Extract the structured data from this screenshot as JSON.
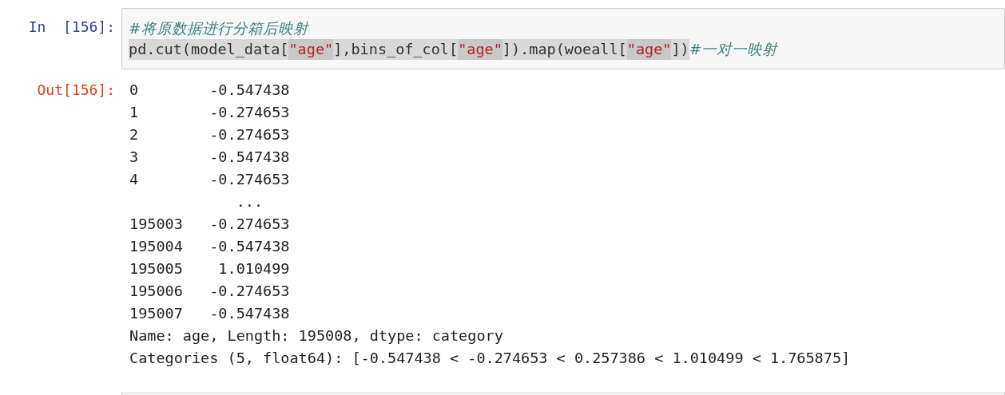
{
  "input_cell": {
    "prompt": "In  [156]:",
    "lines": [
      [
        {
          "text": "#将原数据进行分箱后映射",
          "kind": "comment",
          "highlighted": false
        }
      ],
      [
        {
          "text": "pd.cut(model_data[",
          "kind": "code",
          "highlighted": true
        },
        {
          "text": "\"age\"",
          "kind": "string",
          "highlighted": true
        },
        {
          "text": "],bins_of_col[",
          "kind": "code",
          "highlighted": true
        },
        {
          "text": "\"age\"",
          "kind": "string",
          "highlighted": true
        },
        {
          "text": "]).map(woeall[",
          "kind": "code",
          "highlighted": true
        },
        {
          "text": "\"age\"",
          "kind": "string",
          "highlighted": true
        },
        {
          "text": "])",
          "kind": "code",
          "highlighted": true
        },
        {
          "text": "#一对一映射",
          "kind": "comment",
          "highlighted": false
        }
      ]
    ]
  },
  "output_cell": {
    "prompt": "Out[156]:",
    "rows": [
      {
        "kind": "row",
        "index": "0",
        "value": "-0.547438"
      },
      {
        "kind": "row",
        "index": "1",
        "value": "-0.274653"
      },
      {
        "kind": "row",
        "index": "2",
        "value": "-0.274653"
      },
      {
        "kind": "row",
        "index": "3",
        "value": "-0.547438"
      },
      {
        "kind": "row",
        "index": "4",
        "value": "-0.274653"
      },
      {
        "kind": "ellipsis",
        "value": "..."
      },
      {
        "kind": "row",
        "index": "195003",
        "value": "-0.274653"
      },
      {
        "kind": "row",
        "index": "195004",
        "value": "-0.547438"
      },
      {
        "kind": "row",
        "index": "195005",
        "value": "1.010499"
      },
      {
        "kind": "row",
        "index": "195006",
        "value": "-0.274653"
      },
      {
        "kind": "row",
        "index": "195007",
        "value": "-0.547438"
      }
    ],
    "footer": [
      "Name: age, Length: 195008, dtype: category",
      "Categories (5, float64): [-0.547438 < -0.274653 < 0.257386 < 1.010499 < 1.765875]"
    ]
  }
}
